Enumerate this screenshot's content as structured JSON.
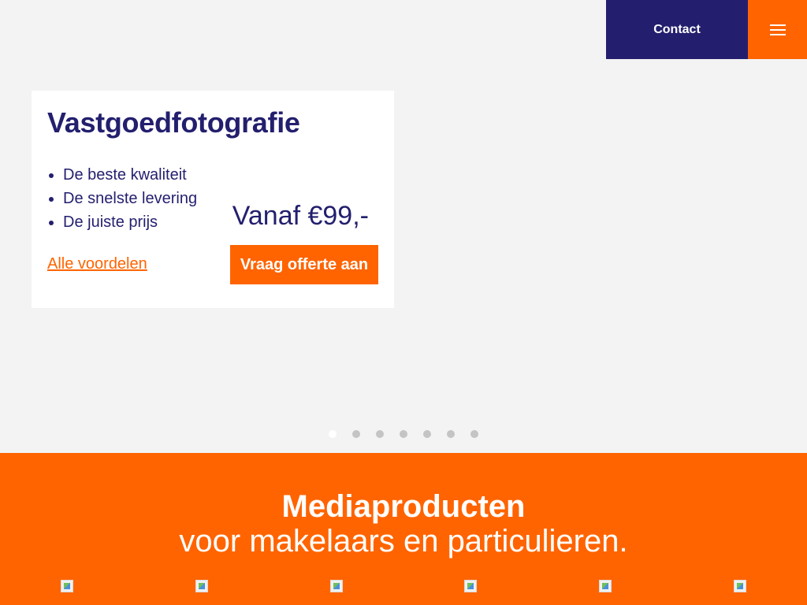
{
  "nav": {
    "contact_label": "Contact",
    "menu_icon": "hamburger-menu-icon"
  },
  "hero": {
    "title": "Vastgoedfotografie",
    "benefits": [
      "De beste kwaliteit",
      "De snelste levering",
      "De juiste prijs"
    ],
    "price": "Vanaf €99,-",
    "more_link": "Alle voordelen",
    "cta": "Vraag offerte aan"
  },
  "slider": {
    "slide_count": 7,
    "active_index": 0
  },
  "products_section": {
    "title": "Mediaproducten",
    "subtitle": "voor makelaars en particulieren.",
    "image_count": 6
  },
  "colors": {
    "navy": "#231f6e",
    "orange": "#ff6400",
    "background": "#f3f3f3"
  }
}
